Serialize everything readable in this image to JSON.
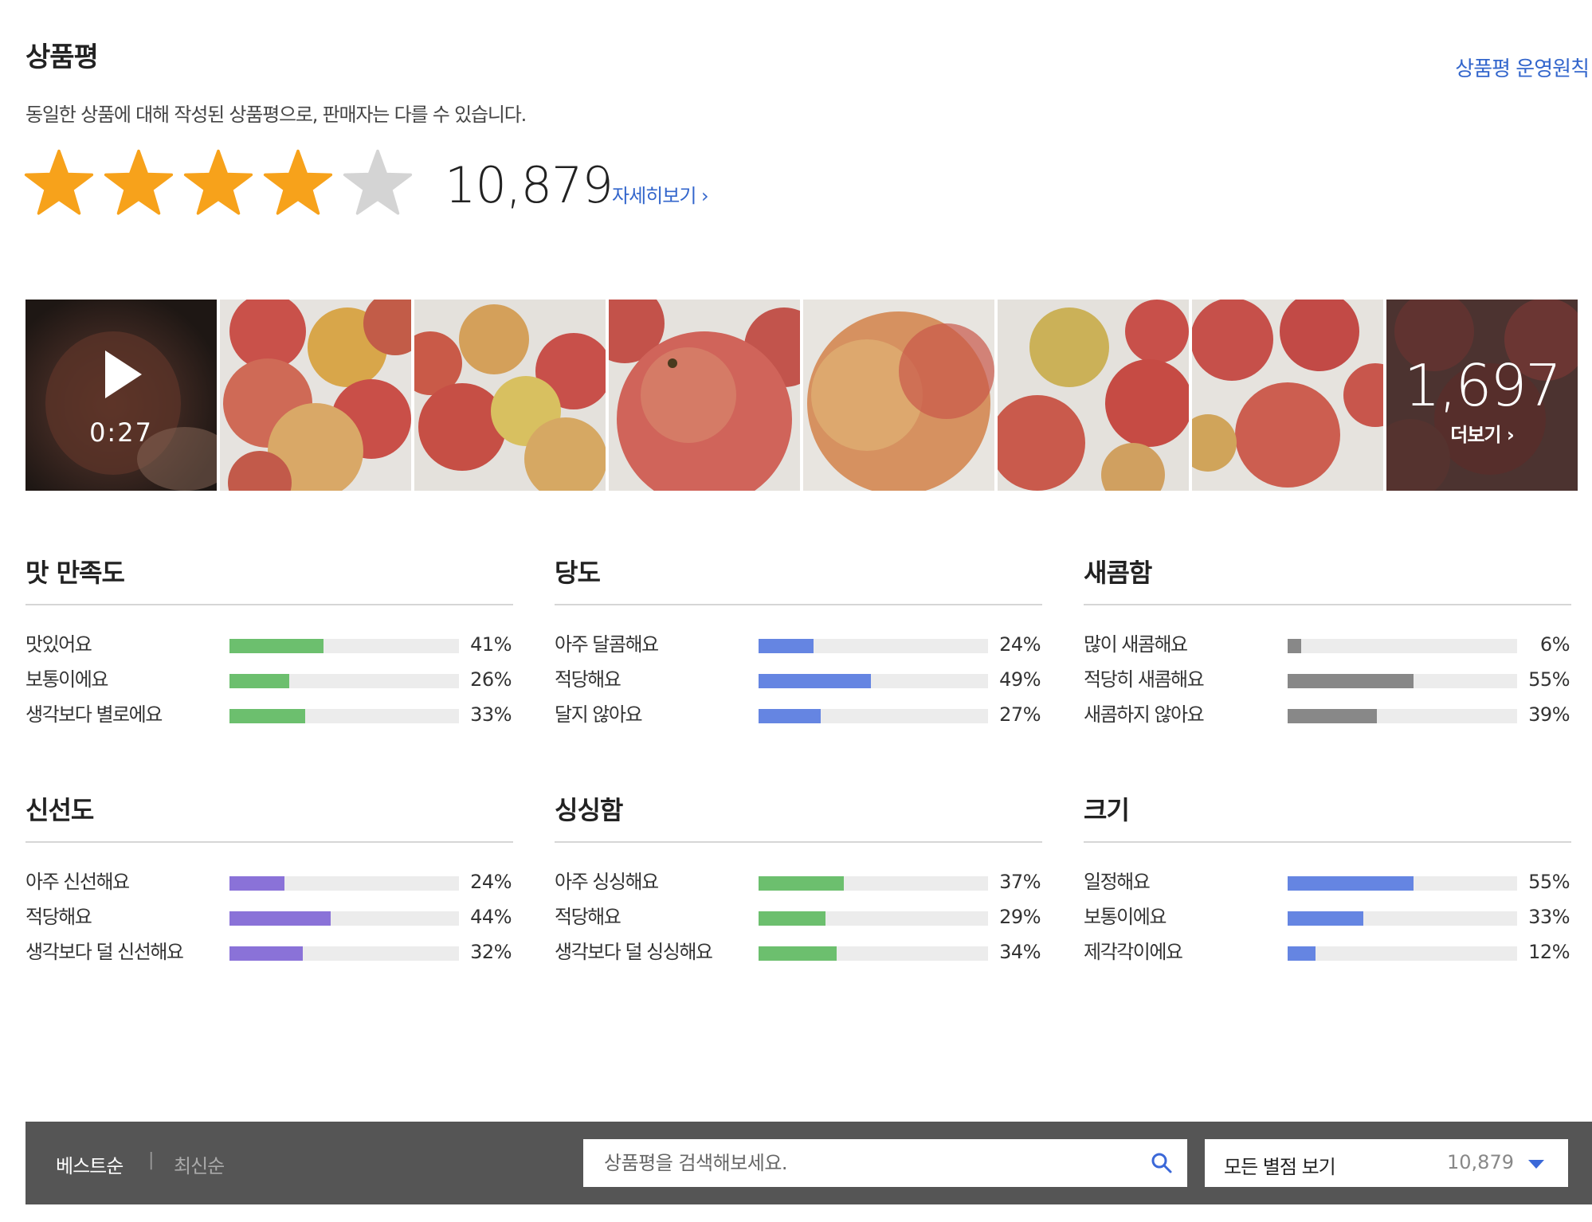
{
  "header": {
    "title": "상품평",
    "policy_link": "상품평 운영원칙",
    "subtitle": "동일한 상품에 대해 작성된 상품평으로, 판매자는 다를 수 있습니다."
  },
  "rating": {
    "stars_filled": 4,
    "stars_total": 5,
    "count": "10,879",
    "detail_link": "자세히보기",
    "star_color": "#f7a21b",
    "star_empty_color": "#d4d4d4"
  },
  "photos": {
    "video_time": "0:27",
    "more_count": "1,697",
    "more_label": "더보기"
  },
  "surveys": [
    {
      "title": "맛 만족도",
      "color": "#6cbf6e",
      "rows": [
        {
          "label": "맛있어요",
          "pct": "41%",
          "value": 41
        },
        {
          "label": "보통이에요",
          "pct": "26%",
          "value": 26
        },
        {
          "label": "생각보다 별로에요",
          "pct": "33%",
          "value": 33
        }
      ]
    },
    {
      "title": "당도",
      "color": "#6585e2",
      "rows": [
        {
          "label": "아주 달콤해요",
          "pct": "24%",
          "value": 24
        },
        {
          "label": "적당해요",
          "pct": "49%",
          "value": 49
        },
        {
          "label": "달지 않아요",
          "pct": "27%",
          "value": 27
        }
      ]
    },
    {
      "title": "새콤함",
      "color": "#888888",
      "rows": [
        {
          "label": "많이 새콤해요",
          "pct": "6%",
          "value": 6
        },
        {
          "label": "적당히 새콤해요",
          "pct": "55%",
          "value": 55
        },
        {
          "label": "새콤하지 않아요",
          "pct": "39%",
          "value": 39
        }
      ]
    },
    {
      "title": "신선도",
      "color": "#8a72d8",
      "rows": [
        {
          "label": "아주 신선해요",
          "pct": "24%",
          "value": 24
        },
        {
          "label": "적당해요",
          "pct": "44%",
          "value": 44
        },
        {
          "label": "생각보다 덜 신선해요",
          "pct": "32%",
          "value": 32
        }
      ]
    },
    {
      "title": "싱싱함",
      "color": "#6cbf6e",
      "rows": [
        {
          "label": "아주 싱싱해요",
          "pct": "37%",
          "value": 37
        },
        {
          "label": "적당해요",
          "pct": "29%",
          "value": 29
        },
        {
          "label": "생각보다 덜 싱싱해요",
          "pct": "34%",
          "value": 34
        }
      ]
    },
    {
      "title": "크기",
      "color": "#6585e2",
      "rows": [
        {
          "label": "일정해요",
          "pct": "55%",
          "value": 55
        },
        {
          "label": "보통이에요",
          "pct": "33%",
          "value": 33
        },
        {
          "label": "제각각이에요",
          "pct": "12%",
          "value": 12
        }
      ]
    }
  ],
  "toolbar": {
    "sort_best": "베스트순",
    "sort_separator": "|",
    "sort_new": "최신순",
    "search_placeholder": "상품평을 검색해보세요.",
    "filter_label": "모든 별점 보기",
    "filter_count": "10,879",
    "icon": "search-icon"
  }
}
